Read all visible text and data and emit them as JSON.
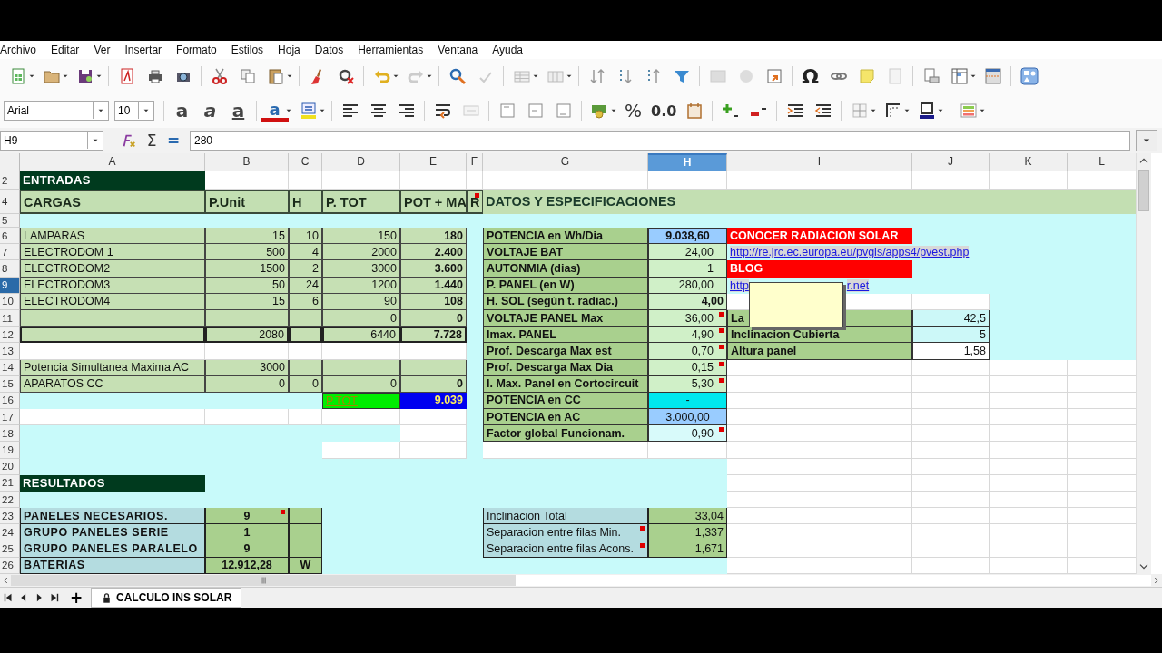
{
  "menu": [
    "Archivo",
    "Editar",
    "Ver",
    "Insertar",
    "Formato",
    "Estilos",
    "Hoja",
    "Datos",
    "Herramientas",
    "Ventana",
    "Ayuda"
  ],
  "toolbar": {
    "glyphs": [
      "Ω"
    ]
  },
  "format_bar": {
    "font": "Arial",
    "size": "10",
    "glyphs": [
      "a",
      "a",
      "a",
      "a",
      "%",
      "0.0"
    ]
  },
  "formula_bar": {
    "cell": "H9",
    "buttons": [
      "Σ",
      "="
    ],
    "value": "280"
  },
  "columns": [
    {
      "label": "A",
      "selected": false
    },
    {
      "label": "B",
      "selected": false
    },
    {
      "label": "C",
      "selected": false
    },
    {
      "label": "D",
      "selected": false
    },
    {
      "label": "E",
      "selected": false
    },
    {
      "label": "F",
      "selected": false
    },
    {
      "label": "G",
      "selected": false
    },
    {
      "label": "H",
      "selected": true
    },
    {
      "label": "I",
      "selected": false
    },
    {
      "label": "J",
      "selected": false
    },
    {
      "label": "K",
      "selected": false
    },
    {
      "label": "L",
      "selected": false
    }
  ],
  "rows": [
    {
      "num": "2",
      "selected": false,
      "cells": [
        {
          "kind": "title",
          "text": "ENTRADAS"
        },
        {
          "kind": "blank"
        },
        {
          "kind": "blank"
        },
        {
          "kind": "blank"
        },
        {
          "kind": "blank"
        },
        {
          "kind": "blank"
        },
        {
          "kind": "blank"
        },
        {
          "kind": "blank"
        },
        {
          "kind": "blank"
        },
        {
          "kind": "blank"
        },
        {
          "kind": "blank"
        },
        {
          "kind": "blank"
        }
      ]
    },
    {
      "num": "4",
      "selected": false,
      "cells": [
        {
          "kind": "head",
          "text": "CARGAS"
        },
        {
          "kind": "head",
          "text": "P.Unit"
        },
        {
          "kind": "head",
          "text": "H"
        },
        {
          "kind": "head",
          "text": "P. TOT"
        },
        {
          "kind": "head",
          "text": "POT + MA"
        },
        {
          "kind": "head",
          "text": "R",
          "comment": true
        },
        {
          "kind": "band",
          "text": "DATOS Y ESPECIFICACIONES"
        },
        {
          "kind": "band"
        },
        {
          "kind": "band"
        },
        {
          "kind": "band"
        },
        {
          "kind": "band"
        },
        {
          "kind": "band"
        }
      ]
    },
    {
      "num": "5",
      "selected": false,
      "cells": [
        {
          "kind": "sky"
        },
        {
          "kind": "sky"
        },
        {
          "kind": "sky"
        },
        {
          "kind": "sky"
        },
        {
          "kind": "sky"
        },
        {
          "kind": "sky"
        },
        {
          "kind": "sky"
        },
        {
          "kind": "sky"
        },
        {
          "kind": "sky"
        },
        {
          "kind": "sky"
        },
        {
          "kind": "sky"
        },
        {
          "kind": "sky"
        }
      ]
    },
    {
      "num": "6",
      "selected": false,
      "cells": [
        {
          "kind": "in",
          "text": "LAMPARAS"
        },
        {
          "kind": "num",
          "text": "15"
        },
        {
          "kind": "num",
          "text": "10"
        },
        {
          "kind": "num",
          "text": "150"
        },
        {
          "kind": "numb",
          "text": "180"
        },
        {
          "kind": "sky"
        },
        {
          "kind": "label",
          "text": "POTENCIA en Wh/Dia"
        },
        {
          "kind": "hl",
          "text": "9.038,60"
        },
        {
          "kind": "red",
          "text": "CONOCER RADIACION SOLAR"
        },
        {
          "kind": "sky"
        },
        {
          "kind": "sky"
        },
        {
          "kind": "sky"
        }
      ]
    },
    {
      "num": "7",
      "selected": false,
      "cells": [
        {
          "kind": "in",
          "text": "ELECTRODOM 1"
        },
        {
          "kind": "num",
          "text": "500"
        },
        {
          "kind": "num",
          "text": "4"
        },
        {
          "kind": "num",
          "text": "2000"
        },
        {
          "kind": "numb",
          "text": "2.400"
        },
        {
          "kind": "sky"
        },
        {
          "kind": "label",
          "text": "VOLTAJE BAT"
        },
        {
          "kind": "val",
          "text": "24,00"
        },
        {
          "kind": "link",
          "text": "http://re.jrc.ec.europa.eu/pvgis/apps4/pvest.php"
        },
        {
          "kind": "link"
        },
        {
          "kind": "sky"
        },
        {
          "kind": "sky"
        }
      ]
    },
    {
      "num": "8",
      "selected": false,
      "cells": [
        {
          "kind": "in",
          "text": "ELECTRODOM2"
        },
        {
          "kind": "num",
          "text": "1500"
        },
        {
          "kind": "num",
          "text": "2"
        },
        {
          "kind": "num",
          "text": "3000"
        },
        {
          "kind": "numb",
          "text": "3.600"
        },
        {
          "kind": "sky"
        },
        {
          "kind": "label",
          "text": "AUTONMIA (dias)"
        },
        {
          "kind": "val",
          "text": "1"
        },
        {
          "kind": "red",
          "text": "BLOG"
        },
        {
          "kind": "sky"
        },
        {
          "kind": "sky"
        },
        {
          "kind": "sky"
        }
      ]
    },
    {
      "num": "9",
      "selected": true,
      "cells": [
        {
          "kind": "in",
          "text": "ELECTRODOM3"
        },
        {
          "kind": "num",
          "text": "50"
        },
        {
          "kind": "num",
          "text": "24"
        },
        {
          "kind": "num",
          "text": "1200"
        },
        {
          "kind": "numb",
          "text": "1.440"
        },
        {
          "kind": "sky"
        },
        {
          "kind": "label",
          "text": "P. PANEL (en W)"
        },
        {
          "kind": "val",
          "text": "280,00"
        },
        {
          "kind": "link",
          "text": "http",
          "tail": "r.net"
        },
        {
          "kind": "sky"
        },
        {
          "kind": "sky"
        },
        {
          "kind": "sky"
        }
      ]
    },
    {
      "num": "10",
      "selected": false,
      "cells": [
        {
          "kind": "in",
          "text": "ELECTRODOM4"
        },
        {
          "kind": "num",
          "text": "15"
        },
        {
          "kind": "num",
          "text": "6"
        },
        {
          "kind": "num",
          "text": "90"
        },
        {
          "kind": "numb",
          "text": "108"
        },
        {
          "kind": "sky"
        },
        {
          "kind": "label",
          "text": "H. SOL (según t. radiac.)"
        },
        {
          "kind": "valb",
          "text": "4,00"
        },
        {
          "kind": "white"
        },
        {
          "kind": "white"
        },
        {
          "kind": "sky"
        },
        {
          "kind": "sky"
        }
      ]
    },
    {
      "num": "11",
      "selected": false,
      "cells": [
        {
          "kind": "in"
        },
        {
          "kind": "num"
        },
        {
          "kind": "num"
        },
        {
          "kind": "num",
          "text": "0"
        },
        {
          "kind": "numb",
          "text": "0"
        },
        {
          "kind": "sky"
        },
        {
          "kind": "label",
          "text": "VOLTAJE PANEL Max"
        },
        {
          "kind": "val",
          "text": "36,00",
          "comment": true
        },
        {
          "kind": "label",
          "text": "La"
        },
        {
          "kind": "jval",
          "text": "42,5"
        },
        {
          "kind": "sky"
        },
        {
          "kind": "sky"
        }
      ]
    },
    {
      "num": "12",
      "selected": false,
      "cells": [
        {
          "kind": "tot"
        },
        {
          "kind": "tot",
          "text": "2080"
        },
        {
          "kind": "tot"
        },
        {
          "kind": "tot",
          "text": "6440"
        },
        {
          "kind": "totb",
          "text": "7.728"
        },
        {
          "kind": "sky"
        },
        {
          "kind": "label",
          "text": "Imax. PANEL"
        },
        {
          "kind": "val",
          "text": "4,90",
          "comment": true
        },
        {
          "kind": "label",
          "text": "Inclinacion Cubierta"
        },
        {
          "kind": "jval",
          "text": "5"
        },
        {
          "kind": "sky"
        },
        {
          "kind": "sky"
        }
      ]
    },
    {
      "num": "13",
      "selected": false,
      "cells": [
        {
          "kind": "blank"
        },
        {
          "kind": "blank"
        },
        {
          "kind": "blank"
        },
        {
          "kind": "blank"
        },
        {
          "kind": "blank"
        },
        {
          "kind": "sky"
        },
        {
          "kind": "label",
          "text": "Prof. Descarga Max est"
        },
        {
          "kind": "val",
          "text": "0,70",
          "comment": true
        },
        {
          "kind": "label",
          "text": "Altura panel"
        },
        {
          "kind": "wval",
          "text": "1,58"
        },
        {
          "kind": "sky"
        },
        {
          "kind": "sky"
        }
      ]
    },
    {
      "num": "14",
      "selected": false,
      "cells": [
        {
          "kind": "in",
          "text": "Potencia Simultanea Maxima AC"
        },
        {
          "kind": "num",
          "text": "3000"
        },
        {
          "kind": "in"
        },
        {
          "kind": "in"
        },
        {
          "kind": "in"
        },
        {
          "kind": "sky"
        },
        {
          "kind": "label",
          "text": "Prof. Descarga Max Dia"
        },
        {
          "kind": "val",
          "text": "0,15",
          "comment": true
        },
        {
          "kind": "blank"
        },
        {
          "kind": "blank"
        },
        {
          "kind": "blank"
        },
        {
          "kind": "blank"
        }
      ]
    },
    {
      "num": "15",
      "selected": false,
      "cells": [
        {
          "kind": "in",
          "text": "APARATOS CC"
        },
        {
          "kind": "num",
          "text": "0"
        },
        {
          "kind": "num",
          "text": "0"
        },
        {
          "kind": "num",
          "text": "0"
        },
        {
          "kind": "numb",
          "text": "0"
        },
        {
          "kind": "sky"
        },
        {
          "kind": "label",
          "text": "I. Max. Panel en Cortocircuit"
        },
        {
          "kind": "val",
          "text": "5,30",
          "comment": true
        },
        {
          "kind": "blank"
        },
        {
          "kind": "blank"
        },
        {
          "kind": "blank"
        },
        {
          "kind": "blank"
        }
      ]
    },
    {
      "num": "16",
      "selected": false,
      "cells": [
        {
          "kind": "sky"
        },
        {
          "kind": "sky"
        },
        {
          "kind": "sky"
        },
        {
          "kind": "ptot",
          "text": "P.TOT"
        },
        {
          "kind": "blue",
          "text": "9.039"
        },
        {
          "kind": "sky"
        },
        {
          "kind": "label",
          "text": "POTENCIA en CC"
        },
        {
          "kind": "cc",
          "text": "-"
        },
        {
          "kind": "blank"
        },
        {
          "kind": "blank"
        },
        {
          "kind": "blank"
        },
        {
          "kind": "blank"
        }
      ]
    },
    {
      "num": "17",
      "selected": false,
      "cells": [
        {
          "kind": "blank"
        },
        {
          "kind": "blank"
        },
        {
          "kind": "blank"
        },
        {
          "kind": "blank"
        },
        {
          "kind": "blank"
        },
        {
          "kind": "sky"
        },
        {
          "kind": "label",
          "text": "POTENCIA en AC"
        },
        {
          "kind": "ac",
          "text": "3.000,00"
        },
        {
          "kind": "blank"
        },
        {
          "kind": "blank"
        },
        {
          "kind": "blank"
        },
        {
          "kind": "blank"
        }
      ]
    },
    {
      "num": "18",
      "selected": false,
      "cells": [
        {
          "kind": "sky"
        },
        {
          "kind": "sky"
        },
        {
          "kind": "sky"
        },
        {
          "kind": "sky"
        },
        {
          "kind": "blank"
        },
        {
          "kind": "sky"
        },
        {
          "kind": "label",
          "text": "Factor global Funcionam."
        },
        {
          "kind": "cval",
          "text": "0,90",
          "comment": true
        },
        {
          "kind": "blank"
        },
        {
          "kind": "blank"
        },
        {
          "kind": "blank"
        },
        {
          "kind": "blank"
        }
      ]
    },
    {
      "num": "19",
      "selected": false,
      "cells": [
        {
          "kind": "sky"
        },
        {
          "kind": "sky"
        },
        {
          "kind": "sky"
        },
        {
          "kind": "blank"
        },
        {
          "kind": "blank"
        },
        {
          "kind": "sky"
        },
        {
          "kind": "blank"
        },
        {
          "kind": "blank"
        },
        {
          "kind": "blank"
        },
        {
          "kind": "blank"
        },
        {
          "kind": "blank"
        },
        {
          "kind": "blank"
        }
      ]
    },
    {
      "num": "20",
      "selected": false,
      "cells": [
        {
          "kind": "sky"
        },
        {
          "kind": "sky"
        },
        {
          "kind": "sky"
        },
        {
          "kind": "sky"
        },
        {
          "kind": "sky"
        },
        {
          "kind": "sky"
        },
        {
          "kind": "sky"
        },
        {
          "kind": "sky"
        },
        {
          "kind": "blank"
        },
        {
          "kind": "blank"
        },
        {
          "kind": "blank"
        },
        {
          "kind": "blank"
        }
      ]
    },
    {
      "num": "21",
      "selected": false,
      "cells": [
        {
          "kind": "title",
          "text": "RESULTADOS"
        },
        {
          "kind": "sky"
        },
        {
          "kind": "sky"
        },
        {
          "kind": "sky"
        },
        {
          "kind": "sky"
        },
        {
          "kind": "sky"
        },
        {
          "kind": "sky"
        },
        {
          "kind": "sky"
        },
        {
          "kind": "blank"
        },
        {
          "kind": "blank"
        },
        {
          "kind": "blank"
        },
        {
          "kind": "blank"
        }
      ]
    },
    {
      "num": "22",
      "selected": false,
      "cells": [
        {
          "kind": "sky"
        },
        {
          "kind": "sky"
        },
        {
          "kind": "sky"
        },
        {
          "kind": "sky"
        },
        {
          "kind": "sky"
        },
        {
          "kind": "sky"
        },
        {
          "kind": "sky"
        },
        {
          "kind": "sky"
        },
        {
          "kind": "blank"
        },
        {
          "kind": "blank"
        },
        {
          "kind": "blank"
        },
        {
          "kind": "blank"
        }
      ]
    },
    {
      "num": "23",
      "selected": false,
      "cells": [
        {
          "kind": "res",
          "text": "PANELES NECESARIOS."
        },
        {
          "kind": "resval",
          "text": "9",
          "comment": true
        },
        {
          "kind": "resval"
        },
        {
          "kind": "sky"
        },
        {
          "kind": "sky"
        },
        {
          "kind": "sky"
        },
        {
          "kind": "res2",
          "text": "Inclinacion Total"
        },
        {
          "kind": "resnum",
          "text": "33,04"
        },
        {
          "kind": "blank"
        },
        {
          "kind": "blank"
        },
        {
          "kind": "blank"
        },
        {
          "kind": "blank"
        }
      ]
    },
    {
      "num": "24",
      "selected": false,
      "cells": [
        {
          "kind": "res",
          "text": "GRUPO PANELES SERIE"
        },
        {
          "kind": "resval",
          "text": "1"
        },
        {
          "kind": "resval"
        },
        {
          "kind": "sky"
        },
        {
          "kind": "sky"
        },
        {
          "kind": "sky"
        },
        {
          "kind": "res2",
          "text": "Separacion entre filas Min.",
          "comment": true
        },
        {
          "kind": "resnum",
          "text": "1,337"
        },
        {
          "kind": "blank"
        },
        {
          "kind": "blank"
        },
        {
          "kind": "blank"
        },
        {
          "kind": "blank"
        }
      ]
    },
    {
      "num": "25",
      "selected": false,
      "cells": [
        {
          "kind": "res",
          "text": "GRUPO PANELES PARALELO"
        },
        {
          "kind": "resval",
          "text": "9"
        },
        {
          "kind": "resval"
        },
        {
          "kind": "sky"
        },
        {
          "kind": "sky"
        },
        {
          "kind": "sky"
        },
        {
          "kind": "res2",
          "text": "Separacion entre filas Acons.",
          "comment": true
        },
        {
          "kind": "resnum",
          "text": "1,671"
        },
        {
          "kind": "blank"
        },
        {
          "kind": "blank"
        },
        {
          "kind": "blank"
        },
        {
          "kind": "blank"
        }
      ]
    },
    {
      "num": "26",
      "selected": false,
      "cells": [
        {
          "kind": "res",
          "text": "BATERIAS"
        },
        {
          "kind": "resval",
          "text": "12.912,28"
        },
        {
          "kind": "resval",
          "text": "W"
        },
        {
          "kind": "sky"
        },
        {
          "kind": "sky"
        },
        {
          "kind": "sky"
        },
        {
          "kind": "sky"
        },
        {
          "kind": "sky"
        },
        {
          "kind": "blank"
        },
        {
          "kind": "blank"
        },
        {
          "kind": "blank"
        },
        {
          "kind": "blank"
        }
      ]
    }
  ],
  "sheet_tabs": {
    "add": "+",
    "tabs": [
      {
        "label": "CALCULO INS SOLAR",
        "selected": true
      }
    ]
  }
}
